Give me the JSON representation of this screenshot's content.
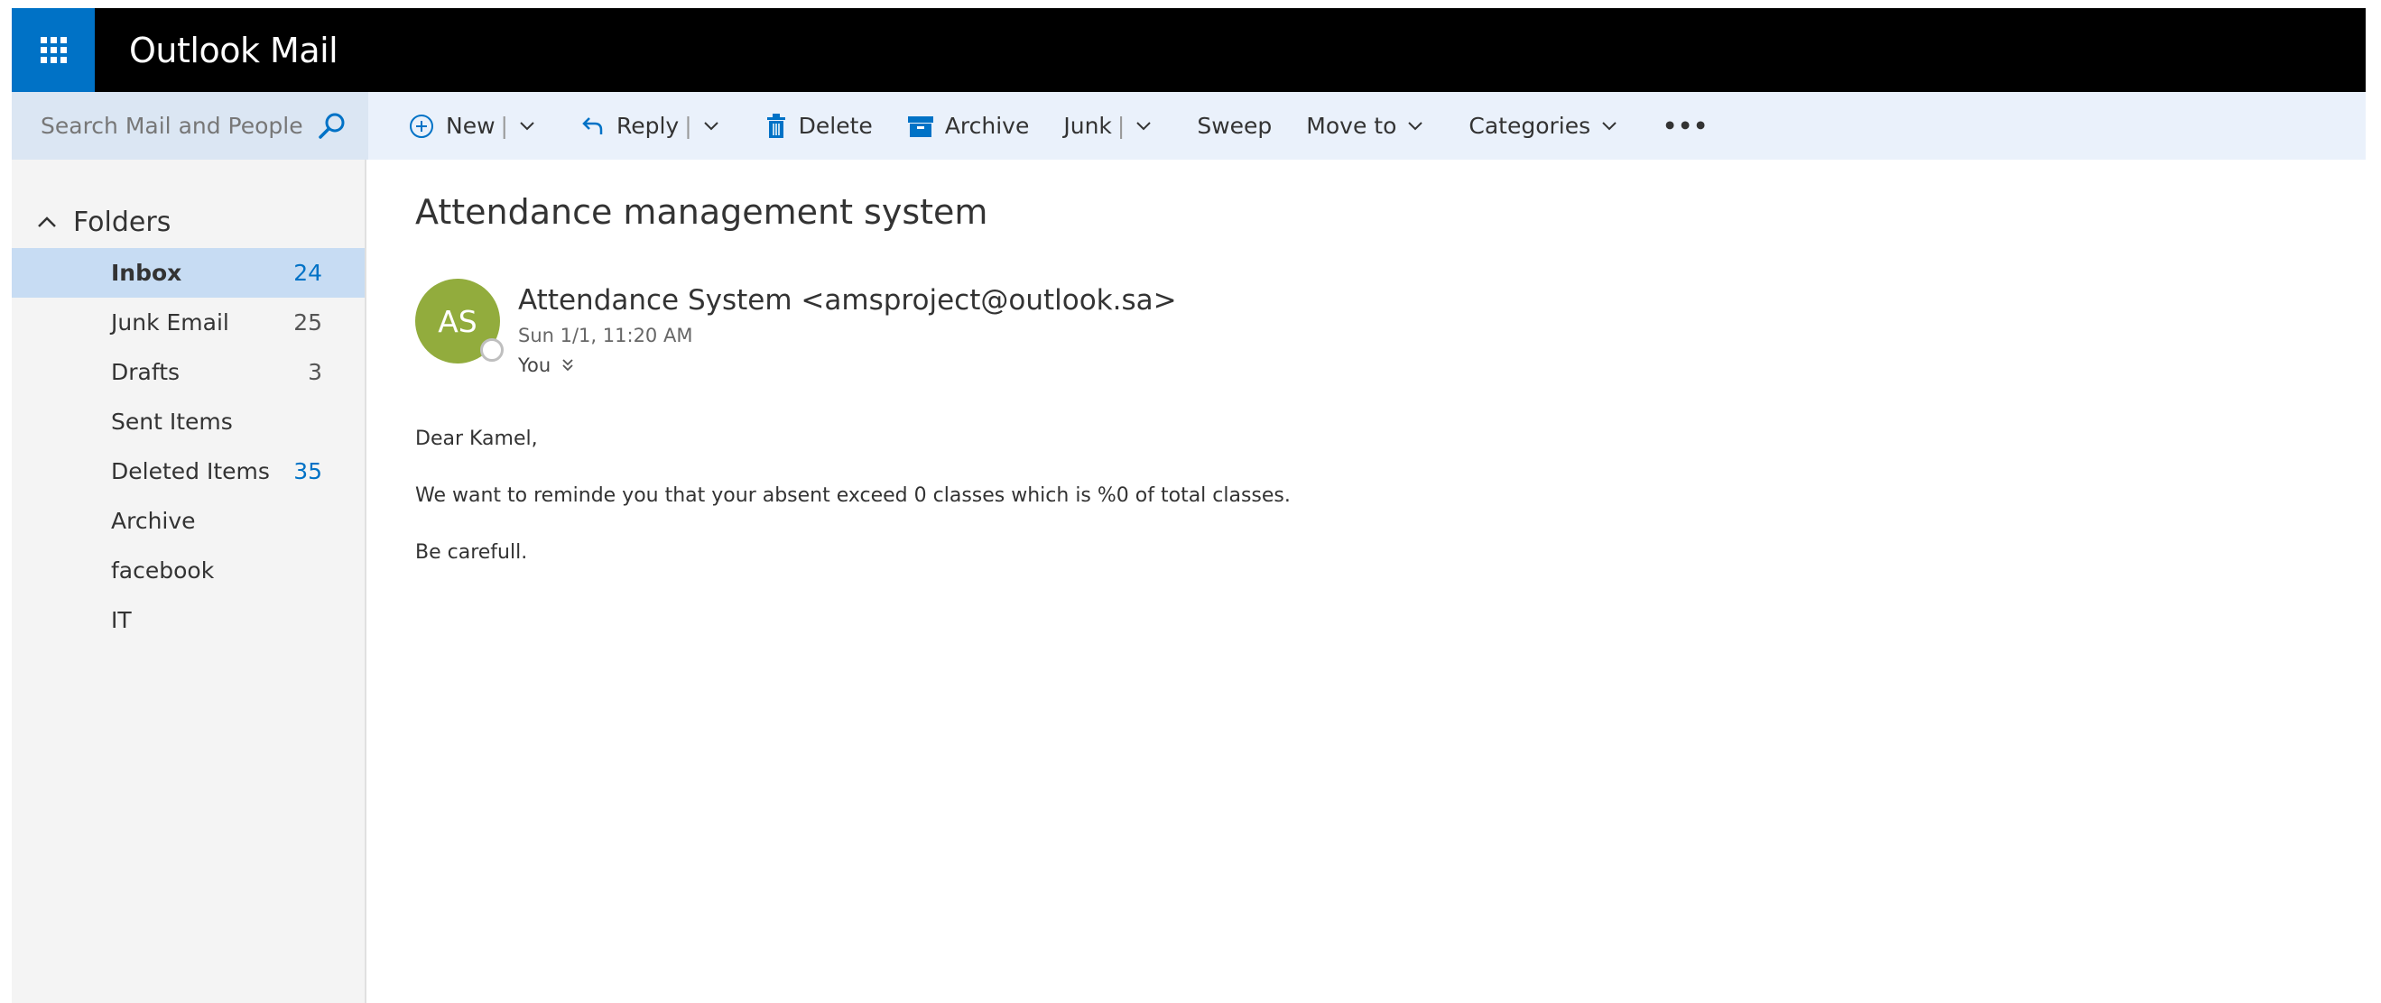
{
  "header": {
    "app_title": "Outlook Mail",
    "brand_color": "#0072c6",
    "waffle_icon": "app-launcher-icon"
  },
  "search": {
    "placeholder": "Search Mail and People",
    "icon": "search-icon"
  },
  "toolbar": {
    "new_label": "New",
    "reply_label": "Reply",
    "delete_label": "Delete",
    "archive_label": "Archive",
    "junk_label": "Junk",
    "sweep_label": "Sweep",
    "move_to_label": "Move to",
    "categories_label": "Categories",
    "more_label": "•••"
  },
  "sidebar": {
    "folders_label": "Folders",
    "items": [
      {
        "label": "Inbox",
        "count": "24",
        "selected": true
      },
      {
        "label": "Junk Email",
        "count": "25"
      },
      {
        "label": "Drafts",
        "count": "3"
      },
      {
        "label": "Sent Items",
        "count": ""
      },
      {
        "label": "Deleted Items",
        "count": "35"
      },
      {
        "label": "Archive",
        "count": ""
      },
      {
        "label": "facebook",
        "count": ""
      },
      {
        "label": "IT",
        "count": ""
      }
    ]
  },
  "message": {
    "subject": "Attendance management system",
    "avatar_initials": "AS",
    "avatar_color": "#92ac3d",
    "sender": "Attendance System <amsproject@outlook.sa>",
    "datetime": "Sun 1/1, 11:20 AM",
    "recipient": "You",
    "body": [
      "Dear Kamel,",
      "We want to reminde you that your absent exceed 0 classes which is %0 of total classes.",
      "Be carefull."
    ]
  }
}
